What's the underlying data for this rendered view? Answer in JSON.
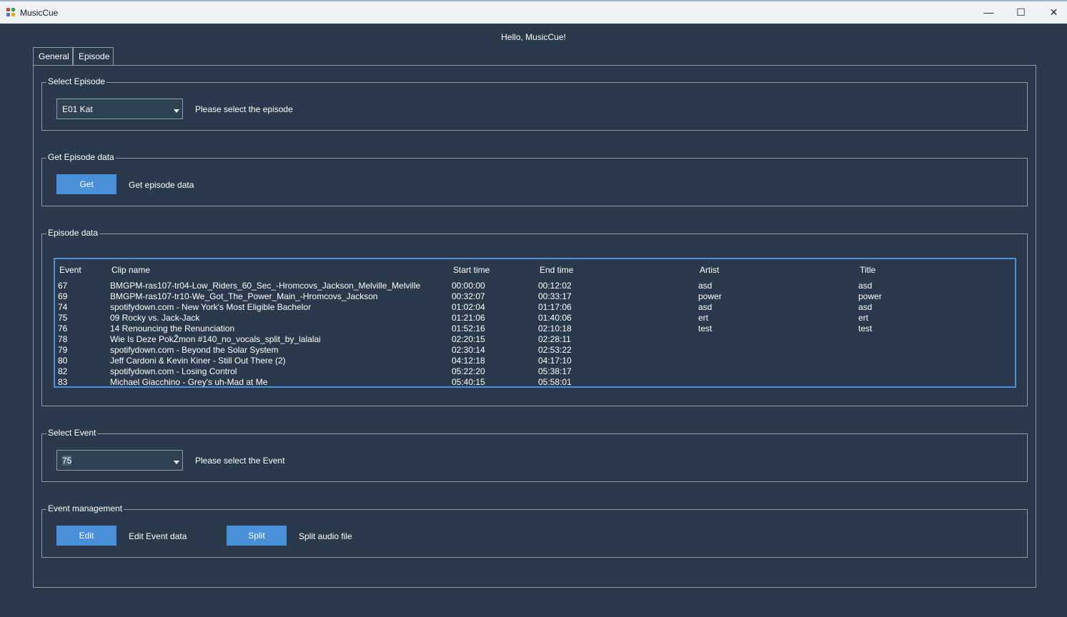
{
  "window": {
    "title": "MusicCue",
    "minimize": "—",
    "maximize": "☐",
    "close": "✕"
  },
  "greeting": "Hello, MusicCue!",
  "tabs": [
    {
      "label": "General"
    },
    {
      "label": "Episode"
    }
  ],
  "select_episode": {
    "group_label": "Select Episode",
    "value": "E01 Kat",
    "hint": "Please select the episode"
  },
  "get_episode_data": {
    "group_label": "Get Episode data",
    "button_label": "Get",
    "hint": "Get episode data"
  },
  "episode_data": {
    "group_label": "Episode data",
    "columns": [
      "Event",
      "Clip name",
      "Start time",
      "End time",
      "Artist",
      "Title"
    ],
    "rows": [
      [
        "67",
        "BMGPM-ras107-tr04-Low_Riders_60_Sec_-Hromcovs_Jackson_Melville_Melville",
        "00:00:00",
        "00:12:02",
        "asd",
        "asd"
      ],
      [
        "69",
        "BMGPM-ras107-tr10-We_Got_The_Power_Main_-Hromcovs_Jackson",
        "00:32:07",
        "00:33:17",
        "power",
        "power"
      ],
      [
        "74",
        "spotifydown.com - New York's Most Eligible Bachelor",
        "01:02:04",
        "01:17:06",
        "asd",
        "asd"
      ],
      [
        "75",
        "09 Rocky vs. Jack-Jack",
        "01:21:06",
        "01:40:06",
        "ert",
        "ert"
      ],
      [
        "76",
        "14 Renouncing the Renunciation",
        "01:52:16",
        "02:10:18",
        "test",
        "test"
      ],
      [
        "78",
        "Wie Is Deze PokŽmon #140_no_vocals_split_by_lalalai",
        "02:20:15",
        "02:28:11",
        "",
        ""
      ],
      [
        "79",
        "spotifydown.com - Beyond the Solar System",
        "02:30:14",
        "02:53:22",
        "",
        ""
      ],
      [
        "80",
        "Jeff Cardoni & Kevin Kiner - Still Out There (2)",
        "04:12:18",
        "04:17:10",
        "",
        ""
      ],
      [
        "82",
        "spotifydown.com - Losing Control",
        "05:22:20",
        "05:38:17",
        "",
        ""
      ],
      [
        "83",
        "Michael Giacchino - Grey's uh-Mad at Me",
        "05:40:15",
        "05:58:01",
        "",
        ""
      ]
    ]
  },
  "select_event": {
    "group_label": "Select Event",
    "value": "75",
    "hint": "Please select the Event"
  },
  "event_management": {
    "group_label": "Event management",
    "edit_button_label": "Edit",
    "edit_hint": "Edit Event data",
    "split_button_label": "Split",
    "split_hint": "Split audio file"
  },
  "colors": {
    "background": "#2a3a4c",
    "accent": "#4a90d9",
    "border": "#8d9aaa"
  }
}
